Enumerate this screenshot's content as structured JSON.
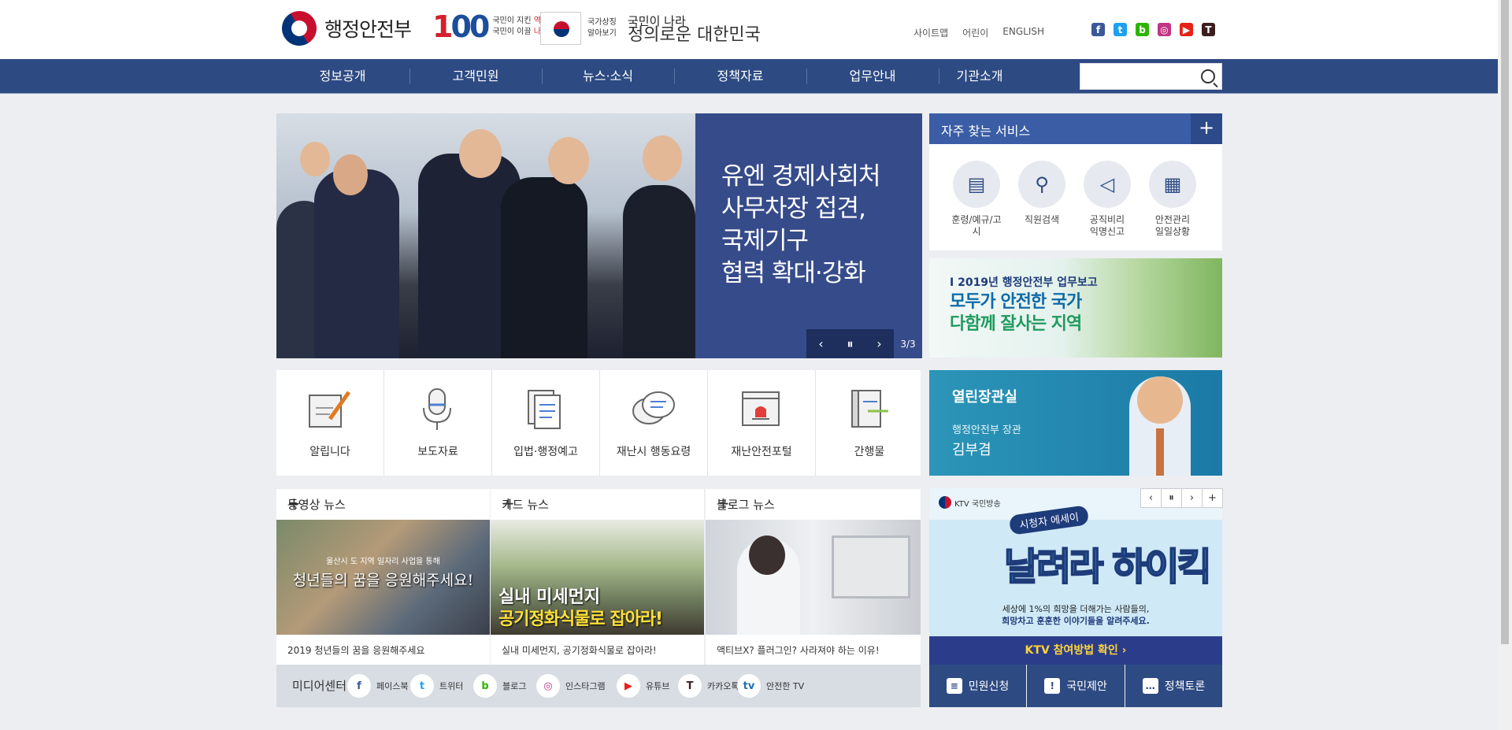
{
  "header": {
    "logo_text": "행정안전부",
    "badge100": {
      "num": "100",
      "line1": "국민이 지킨 ",
      "line1b": "역사",
      "line2": "국민이 이끌 ",
      "line2b": "나라"
    },
    "flag_text": {
      "line1": "국가상징",
      "line2": "알아보기"
    },
    "slogan": {
      "line1": "국민이 나라",
      "line2": "정의로운 대한민국"
    },
    "toplinks": [
      "사이트맵",
      "어린이",
      "ENGLISH"
    ],
    "socials": [
      {
        "icon": "facebook-icon",
        "glyph": "f",
        "color": "#3b5998"
      },
      {
        "icon": "twitter-icon",
        "glyph": "t",
        "color": "#1da1f2"
      },
      {
        "icon": "blog-icon",
        "glyph": "b",
        "color": "#2db400"
      },
      {
        "icon": "instagram-icon",
        "glyph": "◎",
        "color": "#c13584"
      },
      {
        "icon": "youtube-icon",
        "glyph": "▶",
        "color": "#e62117"
      },
      {
        "icon": "kakaotalk-icon",
        "glyph": "T",
        "color": "#3c1e1e"
      }
    ]
  },
  "nav": {
    "items": [
      "정보공개",
      "고객민원",
      "뉴스·소식",
      "정책자료",
      "업무안내",
      "기관소개"
    ],
    "search_placeholder": ""
  },
  "hero": {
    "title_lines": [
      "유엔 경제사회처",
      "사무차장 접견,",
      "국제기구",
      "협력 확대·강화"
    ],
    "controls": {
      "prev": "‹",
      "pause": "⏸",
      "next": "›"
    },
    "pager": "3/3"
  },
  "frequent": {
    "title": "자주 찾는 서비스",
    "plus": "+",
    "items": [
      {
        "label": "훈령/예규/고시",
        "icon": "archive-box-icon",
        "glyph": "▤"
      },
      {
        "label": "직원검색",
        "icon": "people-search-icon",
        "glyph": "⚲"
      },
      {
        "label": "공직비리\n익명신고",
        "icon": "megaphone-icon",
        "glyph": "◁"
      },
      {
        "label": "안전관리\n일일상황",
        "icon": "calendar-icon",
        "glyph": "▦"
      }
    ]
  },
  "banner2": {
    "sub": "I 2019년 행정안전부 업무보고",
    "main1": "모두가 안전한 국가",
    "main2": "다함께 잘사는 지역"
  },
  "quicklinks": [
    {
      "label": "알립니다",
      "icon": "notice-pen-icon"
    },
    {
      "label": "보도자료",
      "icon": "microphone-icon"
    },
    {
      "label": "입법·행정예고",
      "icon": "document-icon"
    },
    {
      "label": "재난시 행동요령",
      "icon": "speech-bubble-icon"
    },
    {
      "label": "재난안전포털",
      "icon": "alarm-siren-icon"
    },
    {
      "label": "간행물",
      "icon": "book-icon"
    }
  ],
  "minister": {
    "title": "열린장관실",
    "subtitle": "행정안전부 장관",
    "name": "김부겸"
  },
  "news": [
    {
      "title": "동영상 뉴스",
      "caption": "2019 청년들의 꿈을 응원해주세요",
      "img_text1": "울산시 도 지역 일자리 사업을 통해",
      "img_text2": "청년들의 꿈을 응원해주세요!"
    },
    {
      "title": "카드 뉴스",
      "caption": "실내 미세먼지, 공기정화식물로 잡아라!",
      "img_text1": "실내 미세먼지",
      "img_text2": "공기정화식물로 잡아라!"
    },
    {
      "title": "블로그 뉴스",
      "caption": "액티브X? 플러그인? 사라져야 하는 이유!",
      "img_text1": "",
      "img_text2": ""
    }
  ],
  "news_plus": "+",
  "media": {
    "title": "미디어센터",
    "items": [
      {
        "label": "페이스북",
        "icon": "facebook-icon",
        "glyph": "f",
        "color": "#3b5998"
      },
      {
        "label": "트위터",
        "icon": "twitter-icon",
        "glyph": "t",
        "color": "#1da1f2"
      },
      {
        "label": "블로그",
        "icon": "blog-icon",
        "glyph": "b",
        "color": "#2db400"
      },
      {
        "label": "인스타그램",
        "icon": "instagram-icon",
        "glyph": "◎",
        "color": "#c13584"
      },
      {
        "label": "유튜브",
        "icon": "youtube-icon",
        "glyph": "▶",
        "color": "#e62117"
      },
      {
        "label": "카카오톡",
        "icon": "kakaotalk-icon",
        "glyph": "T",
        "color": "#3c1e1e"
      },
      {
        "label": "안전한 TV",
        "icon": "safe-tv-icon",
        "glyph": "tv",
        "color": "#1e6fb8"
      }
    ]
  },
  "ktv": {
    "logo": "KTV 국민방송",
    "bubble": "시청자 에세이",
    "big": "날려라 하이킥",
    "desc1": "세상에 1%의 희망을 더해가는 사람들의,",
    "desc2": "희망차고 훈훈한 이야기들을 알려주세요.",
    "button": "KTV 참여방법 확인 ›",
    "controls": [
      "‹",
      "⏸",
      "›",
      "+"
    ]
  },
  "bottom_buttons": [
    {
      "label": "민원신청",
      "icon": "form-icon",
      "glyph": "≡"
    },
    {
      "label": "국민제안",
      "icon": "lightbulb-icon",
      "glyph": "!"
    },
    {
      "label": "정책토론",
      "icon": "chat-icon",
      "glyph": "…"
    }
  ]
}
